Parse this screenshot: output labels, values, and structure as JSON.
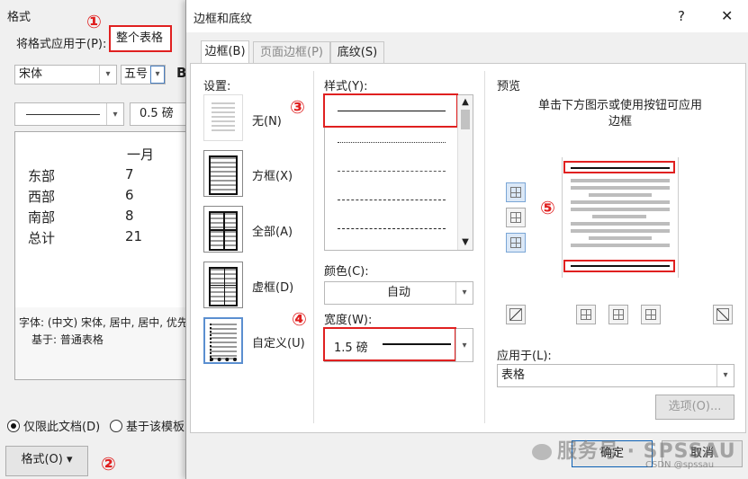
{
  "back": {
    "header": "格式",
    "apply_label": "将格式应用于(P):",
    "apply_value": "整个表格",
    "font": "宋体",
    "size": "五号",
    "bold": "B",
    "line_weight": "0.5 磅",
    "preview": {
      "month": "一月",
      "rows": [
        {
          "label": "东部",
          "value": "7"
        },
        {
          "label": "西部",
          "value": "6"
        },
        {
          "label": "南部",
          "value": "8"
        },
        {
          "label": "总计",
          "value": "21"
        }
      ]
    },
    "desc1": "字体: (中文) 宋体, 居中, 居中, 优先",
    "desc2": "基于: 普通表格",
    "radio1": "仅限此文档(D)",
    "radio2": "基于该模板",
    "format_button": "格式(O) ▾"
  },
  "dialog": {
    "title": "边框和底纹",
    "help": "?",
    "close": "✕",
    "tabs": [
      "边框(B)",
      "页面边框(P)",
      "底纹(S)"
    ],
    "settings_label": "设置:",
    "settings": [
      "无(N)",
      "方框(X)",
      "全部(A)",
      "虚框(D)",
      "自定义(U)"
    ],
    "style_label": "样式(Y):",
    "color_label": "颜色(C):",
    "color_value": "自动",
    "width_label": "宽度(W):",
    "width_value": "1.5 磅",
    "preview_label": "预览",
    "preview_hint": "单击下方图示或使用按钮可应用边框",
    "apply_to_label": "应用于(L):",
    "apply_to_value": "表格",
    "options_button": "选项(O)...",
    "ok_button": "确定",
    "cancel_button": "取消"
  },
  "annotations": [
    "①",
    "②",
    "③",
    "④",
    "⑤"
  ],
  "watermark": "服务号 · SPSSAU",
  "watermark_sub": "CSDN @spssau",
  "colors": {
    "highlight": "#e02020",
    "accent": "#0a5fb4"
  }
}
